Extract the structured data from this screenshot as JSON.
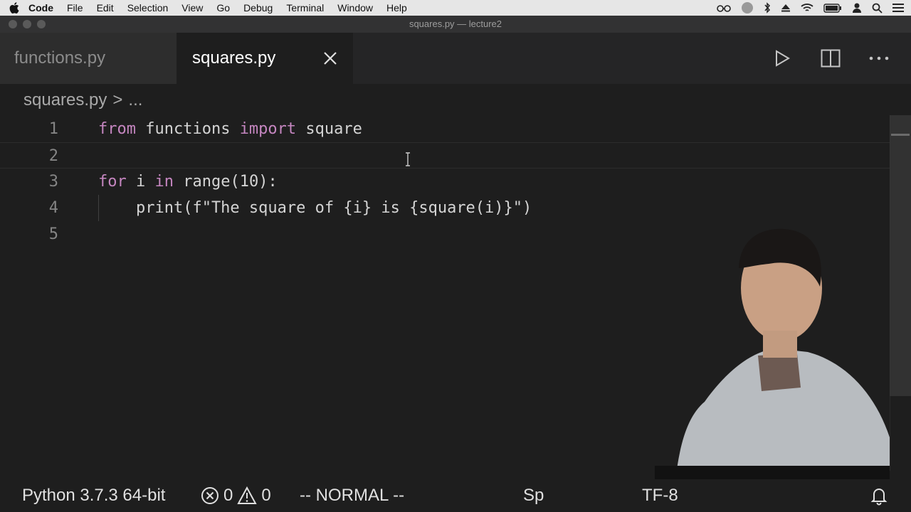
{
  "menubar": {
    "apple": "apple-icon",
    "items": [
      "Code",
      "File",
      "Edit",
      "Selection",
      "View",
      "Go",
      "Debug",
      "Terminal",
      "Window",
      "Help"
    ],
    "status_icons": [
      "glasses-icon",
      "user-circle-icon",
      "bluetooth-icon",
      "eject-icon",
      "wifi-icon",
      "battery-icon",
      "user-icon",
      "search-icon",
      "list-icon"
    ]
  },
  "window": {
    "title": "squares.py — lecture2"
  },
  "tabs": [
    {
      "label": "functions.py",
      "active": false
    },
    {
      "label": "squares.py",
      "active": true
    }
  ],
  "editor_actions": [
    "run-icon",
    "split-editor-icon",
    "more-icon"
  ],
  "breadcrumb": {
    "file": "squares.py",
    "separator": ">",
    "more": "..."
  },
  "code": {
    "line_numbers": [
      "1",
      "2",
      "3",
      "4",
      "5"
    ],
    "lines": [
      [
        "from",
        " functions ",
        "import",
        " square"
      ],
      [],
      [
        "for",
        " i ",
        "in",
        " range(10):"
      ],
      [
        "    print(f\"The square of {i} is {square(i)}\")"
      ],
      []
    ]
  },
  "statusbar": {
    "python": "Python 3.7.3 64-bit",
    "errors": "0",
    "warnings": "0",
    "mode": "-- NORMAL --",
    "spaces": "Sp",
    "encoding": "TF-8"
  },
  "colors": {
    "background": "#1e1e1e",
    "keyword": "#c586c0",
    "text": "#d4d4d4",
    "line_number": "#858585"
  }
}
